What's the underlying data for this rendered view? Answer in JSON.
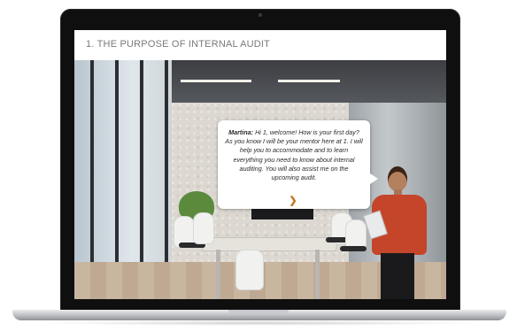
{
  "course": {
    "title": "1. THE PURPOSE OF INTERNAL AUDIT"
  },
  "dialog": {
    "speaker": "Martina:",
    "message": "Hi 1, welcome! How is your first day? As you know I will be your mentor here at 1. I will help you to accommodate and to learn everything you need to know about internal auditing. You will also assist me on the upcoming audit.",
    "next_icon": "chevron-right-icon",
    "next_glyph": "❯"
  },
  "colors": {
    "accent": "#c47a1e",
    "header_text": "#7a7a7a",
    "presenter_blouse": "#c4452a"
  }
}
